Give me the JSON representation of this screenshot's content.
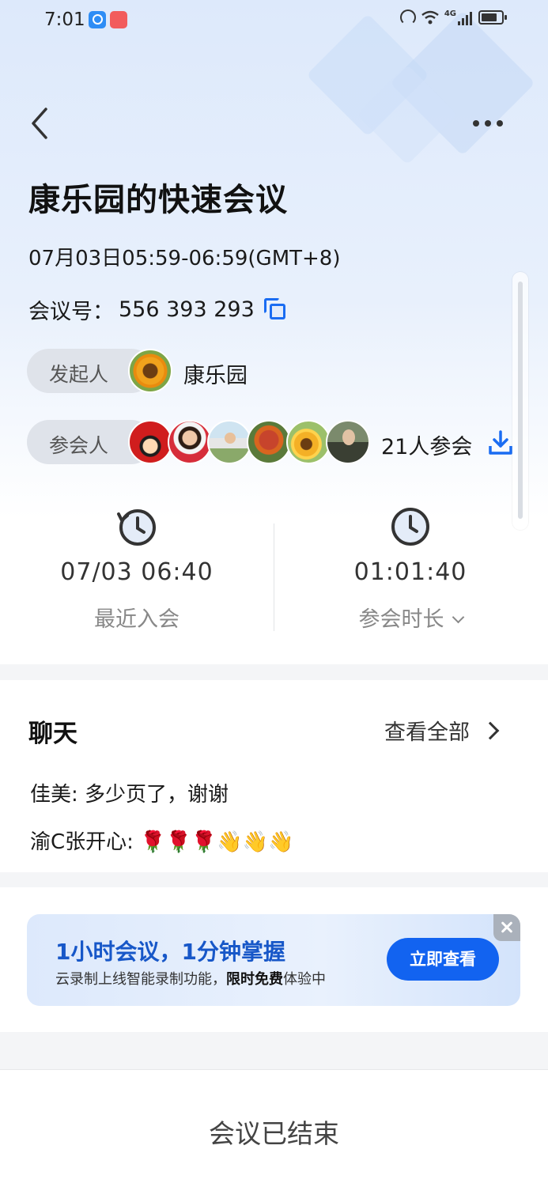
{
  "status_bar": {
    "time": "7:01",
    "network": "4G",
    "battery_level": 0.8
  },
  "meeting": {
    "title": "康乐园的快速会议",
    "time_range": "07月03日05:59-06:59(GMT+8)",
    "meeting_no_label": "会议号：",
    "meeting_no": "556 393 293",
    "host_label": "发起人",
    "host_name": "康乐园",
    "attendees_label": "参会人",
    "attendee_count": "21人参会"
  },
  "stats": {
    "last_join_value": "07/03 06:40",
    "last_join_label": "最近入会",
    "duration_value": "01:01:40",
    "duration_label": "参会时长"
  },
  "chat": {
    "title": "聊天",
    "view_all": "查看全部",
    "messages": [
      {
        "text": "佳美: 多少页了，谢谢"
      },
      {
        "text": "渝C张开心: 🌹🌹🌹👋👋👋"
      }
    ]
  },
  "promo": {
    "title": "1小时会议，1分钟掌握",
    "sub_prefix": "云录制上线智能录制功能，",
    "sub_bold": "限时免费",
    "sub_suffix": "体验中",
    "button": "立即查看"
  },
  "footer": {
    "status": "会议已结束"
  },
  "colors": {
    "accent": "#1263f0",
    "link_blue": "#1a6cf2"
  }
}
